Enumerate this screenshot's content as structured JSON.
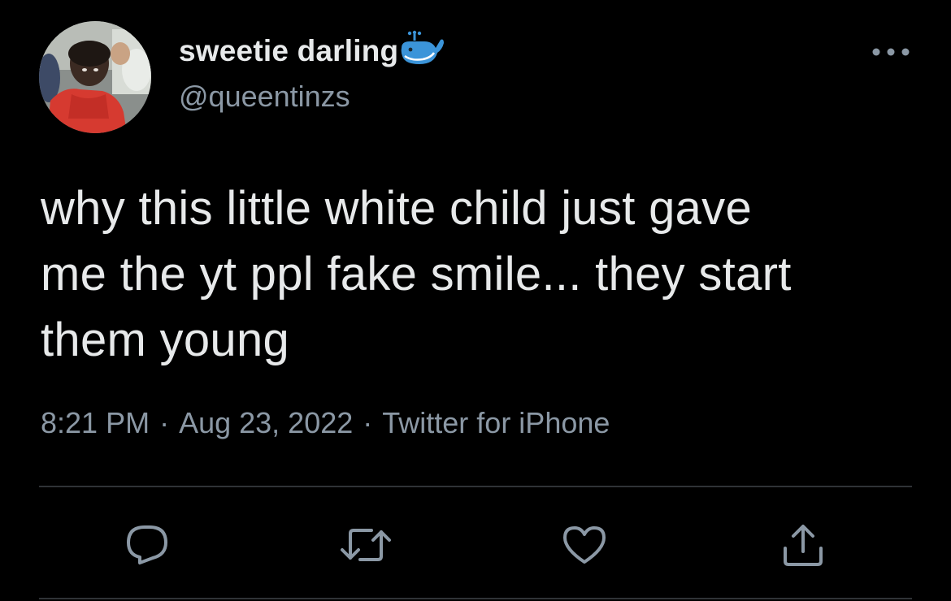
{
  "author": {
    "display_name": "sweetie darling",
    "handle": "@queentinzs",
    "name_emoji": "whale-icon"
  },
  "tweet": {
    "text": "why this little white child just gave\nme the yt ppl fake smile... they start\nthem young"
  },
  "meta": {
    "time": "8:21 PM",
    "separator": "·",
    "date": "Aug 23, 2022",
    "source": "Twitter for iPhone"
  },
  "actions": {
    "reply": "reply-icon",
    "retweet": "retweet-icon",
    "like": "heart-icon",
    "share": "share-icon"
  },
  "colors": {
    "background": "#000000",
    "primary_text": "#e7e9ea",
    "secondary_text": "#8b98a5",
    "divider": "#2f3336",
    "whale": "#3b94d9"
  }
}
